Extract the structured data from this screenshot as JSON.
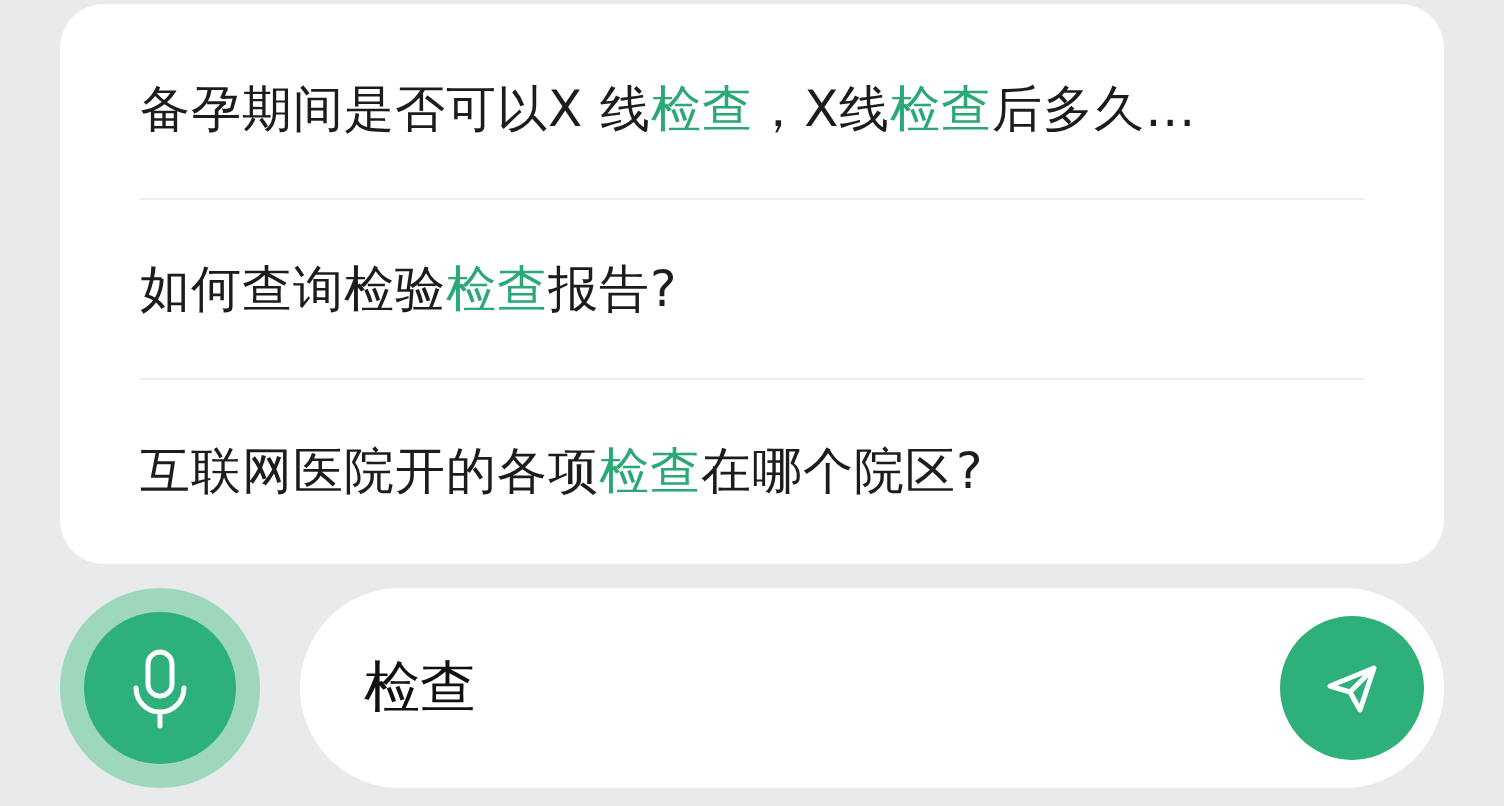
{
  "suggestions": [
    {
      "parts": [
        {
          "text": "备孕期间是否可以X 线",
          "highlight": false
        },
        {
          "text": "检查",
          "highlight": true
        },
        {
          "text": "，X线",
          "highlight": false
        },
        {
          "text": "检查",
          "highlight": true
        },
        {
          "text": "后多久...",
          "highlight": false
        }
      ]
    },
    {
      "parts": [
        {
          "text": "如何查询检验",
          "highlight": false
        },
        {
          "text": "检查",
          "highlight": true
        },
        {
          "text": "报告?",
          "highlight": false
        }
      ]
    },
    {
      "parts": [
        {
          "text": "互联网医院开的各项",
          "highlight": false
        },
        {
          "text": "检查",
          "highlight": true
        },
        {
          "text": "在哪个院区?",
          "highlight": false
        }
      ]
    }
  ],
  "input": {
    "value": "检查"
  }
}
